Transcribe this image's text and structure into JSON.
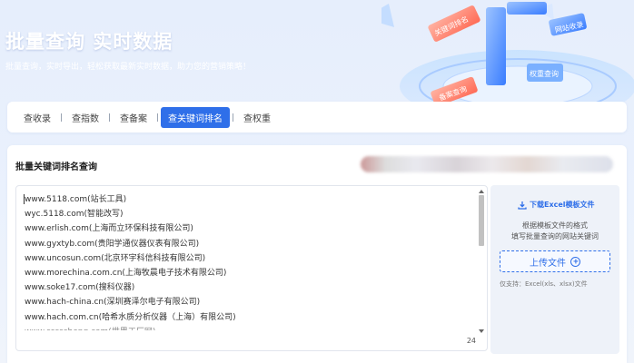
{
  "hero": {
    "title": "批量查询 实时数据",
    "subtitle": "批量查询，实时导出，轻松获取最新实时数据，助力您的营销策略！",
    "art_tags": [
      "关键词排名",
      "网站收录",
      "备案查询",
      "权重查询"
    ]
  },
  "tabs": [
    {
      "label": "查收录",
      "active": false
    },
    {
      "label": "查指数",
      "active": false
    },
    {
      "label": "查备案",
      "active": false
    },
    {
      "label": "查关键词排名",
      "active": true
    },
    {
      "label": "查权重",
      "active": false
    }
  ],
  "panel": {
    "title": "批量关键词排名查询",
    "urls": [
      "www.5118.com(站长工具)",
      "wyc.5118.com(智能改写)",
      "www.erlish.com(上海而立环保科技有限公司)",
      "www.gyxtyb.com(贵阳学通仪器仪表有限公司)",
      "www.uncosun.com(北京环宇科信科技有限公司)",
      "www.morechina.com.cn(上海牧晨电子技术有限公司)",
      "www.soke17.com(搜科仪器)",
      "www.hach-china.cn(深圳赛泽尔电子有限公司)",
      "www.hach.com.cn(哈希水质分析仪器（上海）有限公司)"
    ],
    "cut_line": "www.sssssheng.com(世界工厂网)",
    "count": "24"
  },
  "side": {
    "download_label": "下载Excel模板文件",
    "desc_line1": "根据模板文件的格式",
    "desc_line2": "填写批量查询的网站关键词",
    "upload_label": "上传文件",
    "support_text": "仅支持：Excel(xls、xlsx)文件"
  },
  "colors": {
    "accent": "#2f6fe9",
    "page_bg": "#eaf1fd"
  }
}
